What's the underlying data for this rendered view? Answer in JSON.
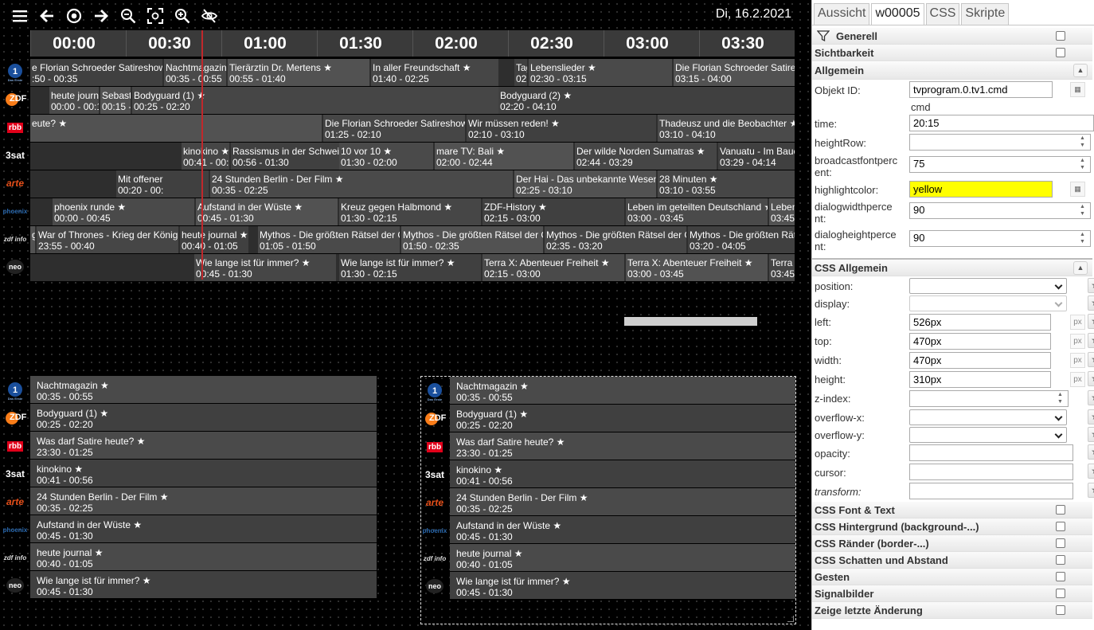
{
  "toolbar": {
    "icons": [
      "menu-icon",
      "arrow-left-icon",
      "target-icon",
      "arrow-right-icon",
      "zoom-out-icon",
      "fit-screen-icon",
      "zoom-in-icon",
      "eye-off-icon"
    ],
    "date": "Di, 16.2.2021"
  },
  "timeline": {
    "times": [
      "00:00",
      "00:30",
      "01:00",
      "01:30",
      "02:00",
      "02:30",
      "03:00",
      "03:30"
    ],
    "channels": [
      {
        "name": "Das Erste",
        "programs": [
          {
            "title": "e Florian Schroeder Satireshow",
            "time": ":50 - 00:35"
          },
          {
            "title": "Nachtmagazin",
            "time": "00:35 - 00:55"
          },
          {
            "title": "Tierärztin Dr. Mertens ★",
            "time": "00:55 - 01:40"
          },
          {
            "title": "In aller Freundschaft ★",
            "time": "01:40 - 02:25"
          },
          {
            "title": "Tag",
            "time": "02:"
          },
          {
            "title": "Lebenslieder ★",
            "time": "02:30 - 03:15"
          },
          {
            "title": "Die Florian Schroeder Satireshow",
            "time": "03:15 - 04:00"
          }
        ]
      },
      {
        "name": "ZDF",
        "programs": [
          {
            "title": "heute journal",
            "time": "00:00 - 00:15"
          },
          {
            "title": "Sebastian",
            "time": "00:15 - 00:"
          },
          {
            "title": "Bodyguard (1) ★",
            "time": "00:25 - 02:20"
          },
          {
            "title": "Bodyguard (2) ★",
            "time": "02:20 - 04:10"
          }
        ]
      },
      {
        "name": "rbb",
        "programs": [
          {
            "title": "eute? ★",
            "time": ""
          },
          {
            "title": "Die Florian Schroeder Satireshow",
            "time": "01:25 - 02:10"
          },
          {
            "title": "Wir müssen reden! ★",
            "time": "02:10 - 03:10"
          },
          {
            "title": "Thadeusz und die Beobachter ★",
            "time": "03:10 - 04:10"
          }
        ]
      },
      {
        "name": "3sat",
        "programs": [
          {
            "title": "kinokino ★",
            "time": "00:41 - 00:56"
          },
          {
            "title": "Rassismus in der Schweiz",
            "time": "00:56 - 01:30"
          },
          {
            "title": "10 vor 10 ★",
            "time": "01:30 - 02:00"
          },
          {
            "title": "mare TV: Bali ★",
            "time": "02:00 - 02:44"
          },
          {
            "title": "Der wilde Norden Sumatras ★",
            "time": "02:44 - 03:29"
          },
          {
            "title": "Vanuatu - Im Bauch",
            "time": "03:29 - 04:14"
          }
        ]
      },
      {
        "name": "arte",
        "programs": [
          {
            "title": "Mit offener",
            "time": "00:20 - 00:"
          },
          {
            "title": "24 Stunden Berlin - Der Film ★",
            "time": "00:35 - 02:25"
          },
          {
            "title": "Der Hai - Das unbekannte Wesen",
            "time": "02:25 - 03:10"
          },
          {
            "title": "28 Minuten ★",
            "time": "03:10 - 03:55"
          }
        ]
      },
      {
        "name": "phoenix",
        "programs": [
          {
            "title": "phoenix runde ★",
            "time": "00:00 - 00:45"
          },
          {
            "title": "Aufstand in der Wüste ★",
            "time": "00:45 - 01:30"
          },
          {
            "title": "Kreuz gegen Halbmond ★",
            "time": "01:30 - 02:15"
          },
          {
            "title": "ZDF-History ★",
            "time": "02:15 - 03:00"
          },
          {
            "title": "Leben im geteilten Deutschland ★",
            "time": "03:00 - 03:45"
          },
          {
            "title": "Leben",
            "time": "03:45"
          }
        ]
      },
      {
        "name": "zdf info",
        "programs": [
          {
            "title": "g",
            "time": ""
          },
          {
            "title": "War of Thrones - Krieg der Königinnen",
            "time": "23:55 - 00:40"
          },
          {
            "title": "heute journal ★",
            "time": "00:40 - 01:05"
          },
          {
            "title": "Mythos - Die größten Rätsel der Geschichte",
            "time": "01:05 - 01:50"
          },
          {
            "title": "Mythos - Die größten Rätsel der Geschichte",
            "time": "01:50 - 02:35"
          },
          {
            "title": "Mythos - Die größten Rätsel der Geschichte",
            "time": "02:35 - 03:20"
          },
          {
            "title": "Mythos - Die größten Rätsel der Geschichte",
            "time": "03:20 - 04:05"
          }
        ]
      },
      {
        "name": "ZDFneo",
        "programs": [
          {
            "title": "Wie lange ist für immer? ★",
            "time": "00:45 - 01:30"
          },
          {
            "title": "Wie lange ist für immer? ★",
            "time": "01:30 - 02:15"
          },
          {
            "title": "Terra X: Abenteuer Freiheit ★",
            "time": "02:15 - 03:00"
          },
          {
            "title": "Terra X: Abenteuer Freiheit ★",
            "time": "03:00 - 03:45"
          },
          {
            "title": "Terra X",
            "time": "03:45"
          }
        ]
      }
    ]
  },
  "now_list": [
    {
      "title": "Nachtmagazin",
      "time": "00:35 - 00:55"
    },
    {
      "title": "Bodyguard (1)",
      "time": "00:25 - 02:20"
    },
    {
      "title": "Was darf Satire heute?",
      "time": "23:30 - 01:25"
    },
    {
      "title": "kinokino",
      "time": "00:41 - 00:56"
    },
    {
      "title": "24 Stunden Berlin - Der Film",
      "time": "00:35 - 02:25"
    },
    {
      "title": "Aufstand in der Wüste",
      "time": "00:45 - 01:30"
    },
    {
      "title": "heute journal",
      "time": "00:40 - 01:05"
    },
    {
      "title": "Wie lange ist für immer?",
      "time": "00:45 - 01:30"
    }
  ],
  "logos": [
    "Das Erste",
    "ZDF",
    "rbb",
    "3sat",
    "arte",
    "phoenix",
    "zdf info",
    "neo"
  ],
  "panel": {
    "tabs": [
      "Aussicht",
      "w00005",
      "CSS",
      "Skripte"
    ],
    "groups": {
      "generell": "Generell",
      "sichtbarkeit": "Sichtbarkeit",
      "allgemein": "Allgemein",
      "css_allgemein": "CSS Allgemein"
    },
    "props": {
      "objekt_id_label": "Objekt ID:",
      "objekt_id_value": "tvprogram.0.tv1.cmd",
      "objekt_id_sub": "cmd",
      "time_label": "time:",
      "time_value": "20:15",
      "heightrow_label": "heightRow:",
      "broadcastfontpercent_label_1": "broadcastfontperc",
      "broadcastfontpercent_label_2": "ent:",
      "broadcastfontpercent_value": "75",
      "highlightcolor_label": "highlightcolor:",
      "highlightcolor_value": "yellow",
      "dialogwidthpercent_label_1": "dialogwidthperce",
      "dialogwidthpercent_label_2": "nt:",
      "dialogwidthpercent_value": "90",
      "dialogheightpercent_label_1": "dialogheightperce",
      "dialogheightpercent_label_2": "nt:",
      "dialogheightpercent_value": "90"
    },
    "css": {
      "position_label": "position:",
      "display_label": "display:",
      "left_label": "left:",
      "left_value": "526px",
      "top_label": "top:",
      "top_value": "470px",
      "width_label": "width:",
      "width_value": "470px",
      "height_label": "height:",
      "height_value": "310px",
      "zindex_label": "z-index:",
      "overflowx_label": "overflow-x:",
      "overflowy_label": "overflow-y:",
      "opacity_label": "opacity:",
      "cursor_label": "cursor:",
      "transform_label": "transform:",
      "px_unit": "px"
    },
    "sections": [
      "CSS Font & Text",
      "CSS Hintergrund (background-...)",
      "CSS Ränder (border-...)",
      "CSS Schatten und Abstand",
      "Gesten",
      "Signalbilder",
      "Zeige letzte Änderung"
    ],
    "highlight_color": "#ffff00"
  }
}
